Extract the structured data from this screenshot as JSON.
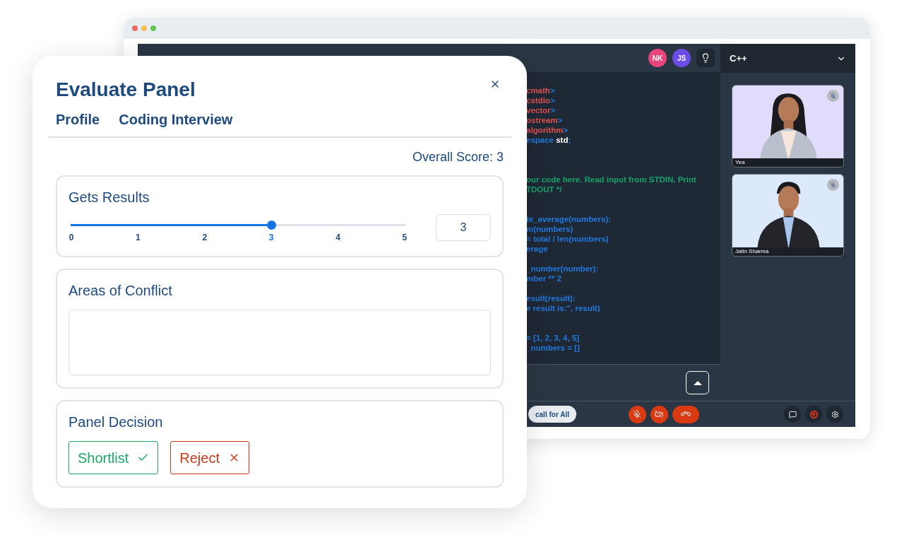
{
  "editor_window": {
    "avatars": [
      {
        "initials": "NK",
        "color": "#e8457a"
      },
      {
        "initials": "JS",
        "color": "#6b4de6"
      }
    ],
    "language_select": {
      "value": "C++"
    },
    "code_lines": [
      {
        "kind": "code",
        "tokens": [
          {
            "text": "cmath",
            "kind": "header"
          },
          {
            "text": ">",
            "kind": "punct"
          }
        ]
      },
      {
        "kind": "code",
        "tokens": [
          {
            "text": "cstdio",
            "kind": "header"
          },
          {
            "text": ">",
            "kind": "punct"
          }
        ]
      },
      {
        "kind": "code",
        "tokens": [
          {
            "text": "vector",
            "kind": "header"
          },
          {
            "text": ">",
            "kind": "punct"
          }
        ]
      },
      {
        "kind": "code",
        "tokens": [
          {
            "text": "ostream",
            "kind": "header"
          },
          {
            "text": ">",
            "kind": "punct"
          }
        ]
      },
      {
        "kind": "code",
        "tokens": [
          {
            "text": "algorithm",
            "kind": "header"
          },
          {
            "text": ">",
            "kind": "punct"
          }
        ]
      },
      {
        "kind": "code",
        "tokens": [
          {
            "text": "espace ",
            "kind": "keyword"
          },
          {
            "text": "std",
            "kind": "plain"
          },
          {
            "text": ";",
            "kind": "punct"
          }
        ]
      },
      {
        "kind": "blank"
      },
      {
        "kind": "blank"
      },
      {
        "kind": "blank"
      },
      {
        "kind": "code",
        "tokens": [
          {
            "text": "our code here. Read input from STDIN. Print",
            "kind": "comment"
          }
        ]
      },
      {
        "kind": "code",
        "tokens": [
          {
            "text": "TDOUT */",
            "kind": "comment"
          }
        ]
      },
      {
        "kind": "blank"
      },
      {
        "kind": "blank"
      },
      {
        "kind": "code",
        "tokens": [
          {
            "text": "te_average(numbers):",
            "kind": "keyword"
          }
        ]
      },
      {
        "kind": "code",
        "tokens": [
          {
            "text": "m(numbers)",
            "kind": "keyword"
          }
        ]
      },
      {
        "kind": "code",
        "tokens": [
          {
            "text": "= total / len(numbers)",
            "kind": "keyword"
          }
        ]
      },
      {
        "kind": "code",
        "tokens": [
          {
            "text": "erage",
            "kind": "keyword"
          }
        ]
      },
      {
        "kind": "blank"
      },
      {
        "kind": "code",
        "tokens": [
          {
            "text": "_number(number):",
            "kind": "keyword"
          }
        ]
      },
      {
        "kind": "code",
        "tokens": [
          {
            "text": "mber ** 2",
            "kind": "keyword"
          }
        ]
      },
      {
        "kind": "blank"
      },
      {
        "kind": "code",
        "tokens": [
          {
            "text": "esult(result):",
            "kind": "keyword"
          }
        ]
      },
      {
        "kind": "code",
        "tokens": [
          {
            "text": "e result is:\", result)",
            "kind": "keyword"
          }
        ]
      },
      {
        "kind": "blank"
      },
      {
        "kind": "blank"
      },
      {
        "kind": "code",
        "tokens": [
          {
            "text": "= [1, 2, 3, 4, 5]",
            "kind": "keyword"
          }
        ]
      },
      {
        "kind": "code",
        "tokens": [
          {
            "text": "_numbers = []",
            "kind": "keyword"
          }
        ]
      }
    ],
    "call_pill": "call for All",
    "participants": [
      {
        "name": "Yea",
        "muted": true,
        "kind": "woman"
      },
      {
        "name": "Jatin Sharma",
        "muted": true,
        "kind": "man"
      }
    ]
  },
  "evaluate_panel": {
    "title": "Evaluate Panel",
    "tabs": [
      "Profile",
      "Coding Interview"
    ],
    "overall_score": "Overall Score: 3",
    "criterion": {
      "title": "Gets Results",
      "level": 0.6,
      "value": "3",
      "ticks": [
        {
          "label": "0",
          "selected": false
        },
        {
          "label": "1",
          "selected": false
        },
        {
          "label": "2",
          "selected": false
        },
        {
          "label": "3",
          "selected": true
        },
        {
          "label": "4",
          "selected": false
        },
        {
          "label": "5",
          "selected": false
        }
      ]
    },
    "conflict": {
      "title": "Areas of Conflict"
    },
    "decision": {
      "title": "Panel Decision",
      "options": [
        {
          "label": "Shortlist",
          "kind": "accept"
        },
        {
          "label": "Reject",
          "kind": "reject"
        }
      ]
    }
  }
}
